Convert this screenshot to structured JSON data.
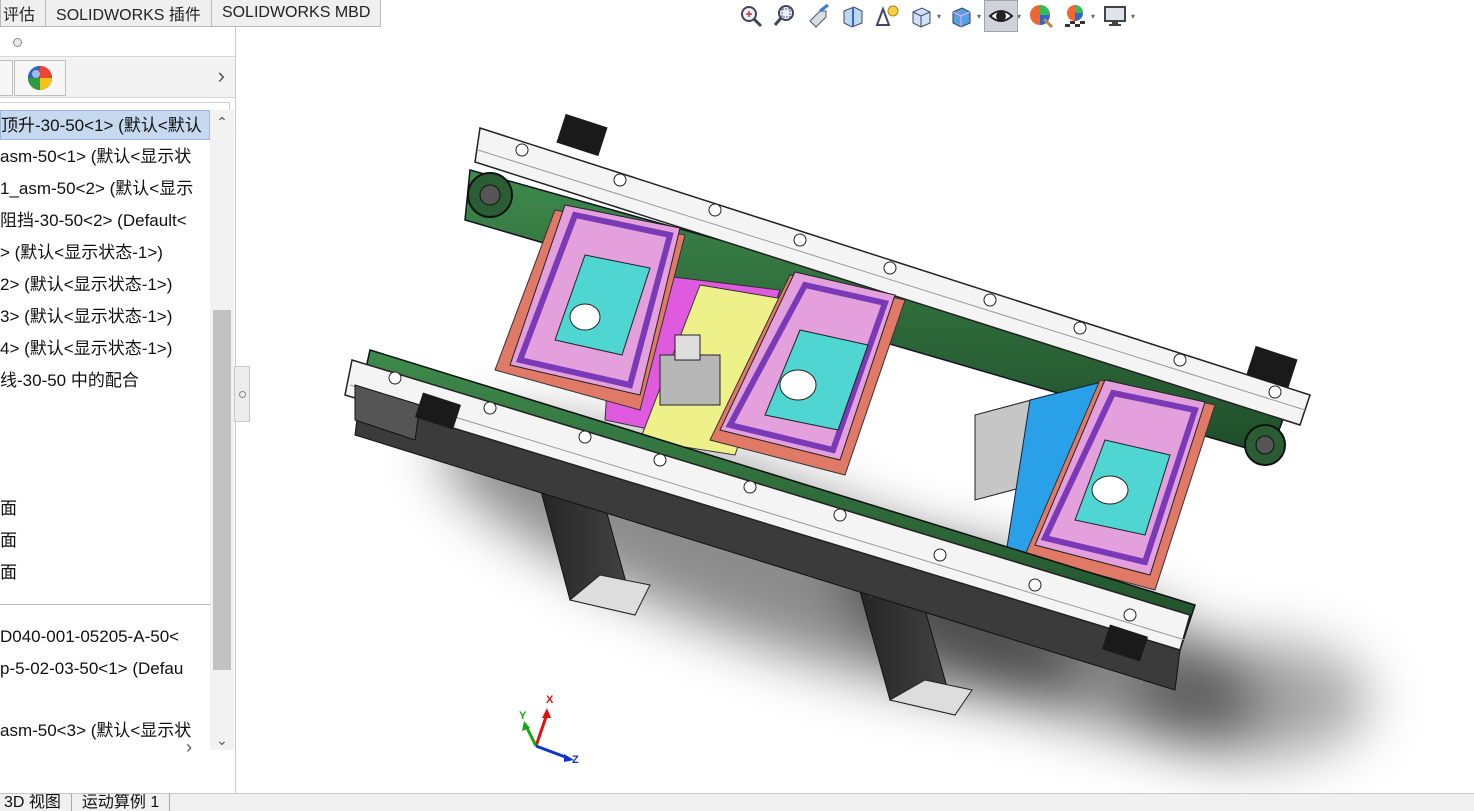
{
  "command_tabs": [
    "评估",
    "SOLIDWORKS 插件",
    "SOLIDWORKS MBD"
  ],
  "heads_up_toolbar": {
    "icons": [
      "zoom-to-fit-icon",
      "zoom-to-area-icon",
      "previous-view-icon",
      "section-view-icon",
      "dynamic-annotation-views-icon",
      "view-orientation-icon",
      "display-style-icon",
      "hide-show-items-icon",
      "edit-appearance-icon",
      "apply-scene-icon",
      "view-settings-icon"
    ],
    "active_icon": "hide-show-items-icon"
  },
  "feature_tree": {
    "rows": [
      "顶升-30-50<1> (默认<默认",
      "asm-50<1> (默认<显示状",
      "1_asm-50<2> (默认<显示",
      "阻挡-30-50<2> (Default<",
      "> (默认<显示状态-1>)",
      "2> (默认<显示状态-1>)",
      "3> (默认<显示状态-1>)",
      "4> (默认<显示状态-1>)",
      "线-30-50 中的配合",
      "",
      "",
      "",
      "面",
      "面",
      "面",
      "",
      "D040-001-05205-A-50<",
      "p-5-02-03-50<1> (Defau",
      "",
      "asm-50<3> (默认<显示状"
    ],
    "selected_index": 0
  },
  "bottom_tabs": [
    "3D 视图",
    "运动算例 1"
  ],
  "triad": {
    "x": "X",
    "y": "Y",
    "z": "Z"
  },
  "colors": {
    "belt_green": "#2e6b3a",
    "frame_white": "#f4f4f4",
    "pallet_pink": "#e3a0dc",
    "pallet_salmon": "#e07a66",
    "plate_cyan": "#4fd6d2",
    "plate_purple": "#7a3ab8",
    "magenta_plate": "#e05ae0",
    "yellow_plate": "#eef08a",
    "motor_blue": "#2aa0e8",
    "selection_blue": "#c7d9ef"
  }
}
